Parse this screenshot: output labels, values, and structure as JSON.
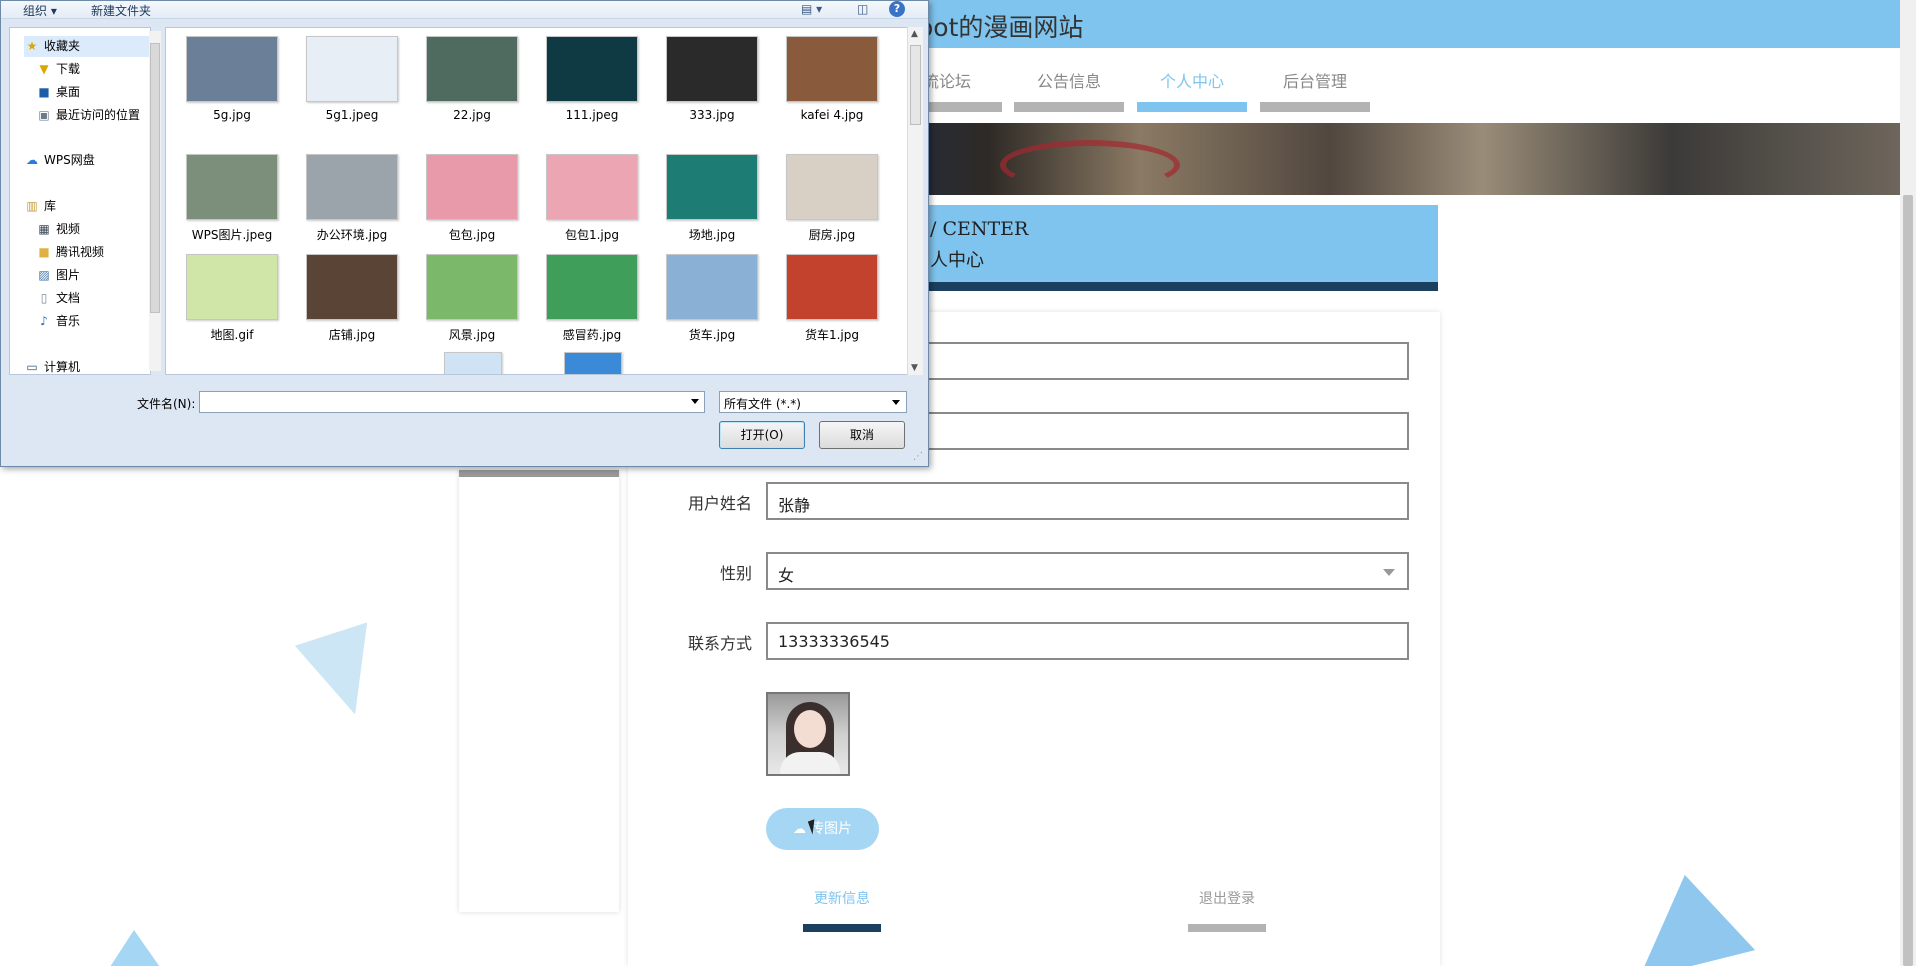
{
  "site": {
    "title": "oot的漫画网站",
    "nav": [
      {
        "label": "流论坛",
        "active": false
      },
      {
        "label": "公告信息",
        "active": false
      },
      {
        "label": "个人中心",
        "active": true
      },
      {
        "label": "后台管理",
        "active": false
      }
    ],
    "center_en": "/ CENTER",
    "center_cn": "人中心"
  },
  "form": {
    "name_label": "用户姓名",
    "name_value": "张静",
    "gender_label": "性别",
    "gender_value": "女",
    "phone_label": "联系方式",
    "phone_value": "13333336545",
    "upload_label": "传图片",
    "upload_icon": "cloud-upload-icon",
    "update_label": "更新信息",
    "logout_label": "退出登录"
  },
  "dialog": {
    "toolbar": {
      "organize": "组织 ▾",
      "new_folder": "新建文件夹",
      "help": "?"
    },
    "nav_items": [
      {
        "label": "收藏夹",
        "icon": "star-icon",
        "selected": true
      },
      {
        "label": "下载",
        "icon": "download-folder-icon"
      },
      {
        "label": "桌面",
        "icon": "desktop-icon"
      },
      {
        "label": "最近访问的位置",
        "icon": "recent-places-icon"
      },
      {
        "label": "WPS网盘",
        "icon": "cloud-icon"
      },
      {
        "label": "库",
        "icon": "library-icon"
      },
      {
        "label": "视频",
        "icon": "video-icon"
      },
      {
        "label": "腾讯视频",
        "icon": "folder-icon"
      },
      {
        "label": "图片",
        "icon": "pictures-icon"
      },
      {
        "label": "文档",
        "icon": "documents-icon"
      },
      {
        "label": "音乐",
        "icon": "music-icon"
      },
      {
        "label": "计算机",
        "icon": "computer-icon"
      }
    ],
    "files": [
      {
        "name": "5g.jpg",
        "color": "#6b7f99"
      },
      {
        "name": "5g1.jpeg",
        "color": "#e8eef6"
      },
      {
        "name": "22.jpg",
        "color": "#4f6a5e"
      },
      {
        "name": "111.jpeg",
        "color": "#0f3a44"
      },
      {
        "name": "333.jpg",
        "color": "#2a2a2a"
      },
      {
        "name": "kafei 4.jpg",
        "color": "#8a5a3c"
      },
      {
        "name": "WPS图片.jpeg",
        "color": "#7c8f7a"
      },
      {
        "name": "办公环境.jpg",
        "color": "#9aa4aa"
      },
      {
        "name": "包包.jpg",
        "color": "#e89aaa"
      },
      {
        "name": "包包1.jpg",
        "color": "#eca5b3"
      },
      {
        "name": "场地.jpg",
        "color": "#1d7c74"
      },
      {
        "name": "厨房.jpg",
        "color": "#d8d0c4"
      },
      {
        "name": "地图.gif",
        "color": "#cfe6a8"
      },
      {
        "name": "店铺.jpg",
        "color": "#5a4436"
      },
      {
        "name": "风景.jpg",
        "color": "#7cb86a"
      },
      {
        "name": "感冒药.jpg",
        "color": "#3e9e5a"
      },
      {
        "name": "货车.jpg",
        "color": "#8ab0d6"
      },
      {
        "name": "货车1.jpg",
        "color": "#c2422e"
      }
    ],
    "filename_label": "文件名(N):",
    "filename_value": "",
    "filetype_value": "所有文件 (*.*)",
    "open_label": "打开(O)",
    "cancel_label": "取消"
  }
}
